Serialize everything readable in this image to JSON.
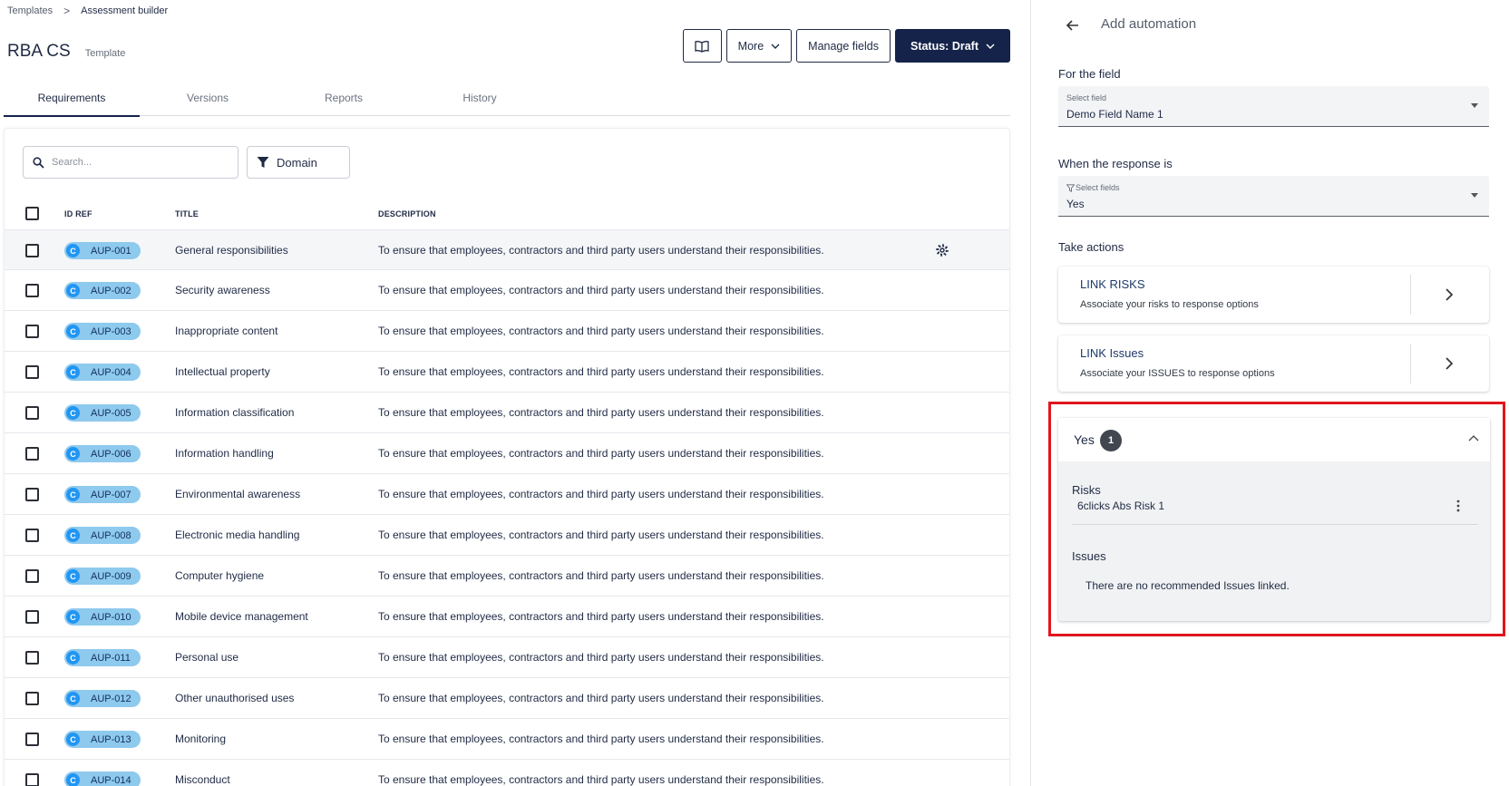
{
  "breadcrumb": {
    "root": "Templates",
    "separator": ">",
    "current": "Assessment builder"
  },
  "header": {
    "title": "RBA CS",
    "subtitle": "Template"
  },
  "toolbar": {
    "more_label": "More",
    "manage_fields_label": "Manage fields",
    "status_label": "Status: Draft"
  },
  "tabs": [
    {
      "label": "Requirements",
      "active": true
    },
    {
      "label": "Versions",
      "active": false
    },
    {
      "label": "Reports",
      "active": false
    },
    {
      "label": "History",
      "active": false
    }
  ],
  "filters": {
    "search_placeholder": "Search...",
    "domain_label": "Domain"
  },
  "table": {
    "columns": {
      "id_ref": "ID REF",
      "title": "TITLE",
      "description": "DESCRIPTION"
    },
    "badge_letter": "C",
    "rows": [
      {
        "id": "AUP-001",
        "title": "General responsibilities",
        "description": "To ensure that employees, contractors and third party users understand their responsibilities."
      },
      {
        "id": "AUP-002",
        "title": "Security awareness",
        "description": "To ensure that employees, contractors and third party users understand their responsibilities."
      },
      {
        "id": "AUP-003",
        "title": "Inappropriate content",
        "description": "To ensure that employees, contractors and third party users understand their responsibilities."
      },
      {
        "id": "AUP-004",
        "title": "Intellectual property",
        "description": "To ensure that employees, contractors and third party users understand their responsibilities."
      },
      {
        "id": "AUP-005",
        "title": "Information classification",
        "description": "To ensure that employees, contractors and third party users understand their responsibilities."
      },
      {
        "id": "AUP-006",
        "title": "Information handling",
        "description": "To ensure that employees, contractors and third party users understand their responsibilities."
      },
      {
        "id": "AUP-007",
        "title": "Environmental awareness",
        "description": "To ensure that employees, contractors and third party users understand their responsibilities."
      },
      {
        "id": "AUP-008",
        "title": "Electronic media handling",
        "description": "To ensure that employees, contractors and third party users understand their responsibilities."
      },
      {
        "id": "AUP-009",
        "title": "Computer hygiene",
        "description": "To ensure that employees, contractors and third party users understand their responsibilities."
      },
      {
        "id": "AUP-010",
        "title": "Mobile device management",
        "description": "To ensure that employees, contractors and third party users understand their responsibilities."
      },
      {
        "id": "AUP-011",
        "title": "Personal use",
        "description": "To ensure that employees, contractors and third party users understand their responsibilities."
      },
      {
        "id": "AUP-012",
        "title": "Other unauthorised uses",
        "description": "To ensure that employees, contractors and third party users understand their responsibilities."
      },
      {
        "id": "AUP-013",
        "title": "Monitoring",
        "description": "To ensure that employees, contractors and third party users understand their responsibilities."
      },
      {
        "id": "AUP-014",
        "title": "Misconduct",
        "description": "To ensure that employees, contractors and third party users understand their responsibilities."
      }
    ]
  },
  "panel": {
    "title": "Add automation",
    "for_field": {
      "label": "For the field",
      "select_label": "Select field",
      "value": "Demo Field Name 1"
    },
    "response": {
      "label": "When the response is",
      "select_label": "Select fields",
      "value": "Yes"
    },
    "take_actions": {
      "label": "Take actions",
      "cards": [
        {
          "title": "LINK RISKS",
          "description": "Associate your risks to response options"
        },
        {
          "title": "LINK Issues",
          "description": "Associate your ISSUES to response options"
        }
      ]
    },
    "accordion": {
      "title": "Yes",
      "count": "1",
      "risks_label": "Risks",
      "risks": [
        "6clicks Abs Risk 1"
      ],
      "issues_label": "Issues",
      "issues_empty": "There are no recommended Issues linked."
    }
  },
  "colors": {
    "primary": "#15234a",
    "highlight": "#e0151d",
    "pill": "#8ec9ee",
    "pill_dot": "#2196f3"
  }
}
